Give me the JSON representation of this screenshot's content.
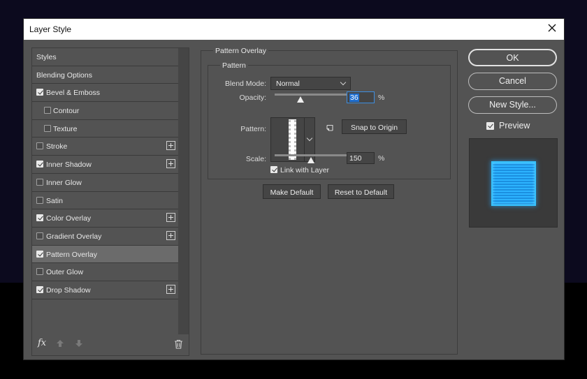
{
  "dialog": {
    "title": "Layer Style",
    "close_icon": "close-icon"
  },
  "styles_list": {
    "items": [
      {
        "label": "Styles",
        "checkbox": false,
        "checked": false,
        "indent": false,
        "plus": false,
        "selected": false
      },
      {
        "label": "Blending Options",
        "checkbox": false,
        "checked": false,
        "indent": false,
        "plus": false,
        "selected": false
      },
      {
        "label": "Bevel & Emboss",
        "checkbox": true,
        "checked": true,
        "indent": false,
        "plus": false,
        "selected": false
      },
      {
        "label": "Contour",
        "checkbox": true,
        "checked": false,
        "indent": true,
        "plus": false,
        "selected": false
      },
      {
        "label": "Texture",
        "checkbox": true,
        "checked": false,
        "indent": true,
        "plus": false,
        "selected": false
      },
      {
        "label": "Stroke",
        "checkbox": true,
        "checked": false,
        "indent": false,
        "plus": true,
        "selected": false
      },
      {
        "label": "Inner Shadow",
        "checkbox": true,
        "checked": true,
        "indent": false,
        "plus": true,
        "selected": false
      },
      {
        "label": "Inner Glow",
        "checkbox": true,
        "checked": false,
        "indent": false,
        "plus": false,
        "selected": false
      },
      {
        "label": "Satin",
        "checkbox": true,
        "checked": false,
        "indent": false,
        "plus": false,
        "selected": false
      },
      {
        "label": "Color Overlay",
        "checkbox": true,
        "checked": true,
        "indent": false,
        "plus": true,
        "selected": false
      },
      {
        "label": "Gradient Overlay",
        "checkbox": true,
        "checked": false,
        "indent": false,
        "plus": true,
        "selected": false
      },
      {
        "label": "Pattern Overlay",
        "checkbox": true,
        "checked": true,
        "indent": false,
        "plus": false,
        "selected": true
      },
      {
        "label": "Outer Glow",
        "checkbox": true,
        "checked": false,
        "indent": false,
        "plus": false,
        "selected": false
      },
      {
        "label": "Drop Shadow",
        "checkbox": true,
        "checked": true,
        "indent": false,
        "plus": true,
        "selected": false
      }
    ],
    "footer": {
      "fx_label": "fx",
      "icons": [
        "fx-icon",
        "move-up-icon",
        "move-down-icon",
        "trash-icon"
      ]
    }
  },
  "pattern_overlay": {
    "section_title": "Pattern Overlay",
    "group_title": "Pattern",
    "blend_mode": {
      "label": "Blend Mode:",
      "value": "Normal"
    },
    "opacity": {
      "label": "Opacity:",
      "value": "36",
      "unit": "%",
      "level": 0.36
    },
    "pattern": {
      "label": "Pattern:",
      "snap_button": "Snap to Origin",
      "new_preset_icon": "new-preset-icon"
    },
    "scale": {
      "label": "Scale:",
      "value": "150",
      "unit": "%",
      "level": 0.5
    },
    "link_with_layer": {
      "label": "Link with Layer",
      "checked": true
    },
    "make_default": "Make Default",
    "reset_to_default": "Reset to Default"
  },
  "actions": {
    "ok": "OK",
    "cancel": "Cancel",
    "new_style": "New Style...",
    "preview": {
      "label": "Preview",
      "checked": true
    }
  },
  "colors": {
    "dialog_bg": "#535353",
    "selected_row": "#6b6b6b",
    "accent": "#1f6fd0",
    "preview_blue": "#2cb3ff"
  }
}
